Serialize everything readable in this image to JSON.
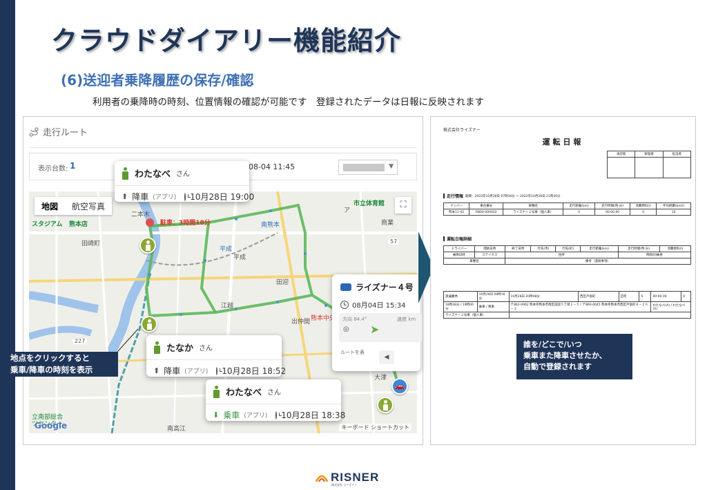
{
  "slide": {
    "title": "クラウドダイアリー機能紹介",
    "subtitle": "(6)送迎者乗降履歴の保存/確認",
    "description": "利用者の乗降時の時刻、位置情報の確認が可能です　登録されたデータは日報に反映されます"
  },
  "app": {
    "route_header": "走行ルート",
    "count_label": "表示台数:",
    "count_value": "1",
    "date_value": "2-08-04 11:45",
    "map_type": {
      "map": "地図",
      "satellite": "航空写真"
    },
    "fullscreen": "⛶",
    "google": "Google",
    "footer": "キーボード ショートカット",
    "labels": {
      "stadium": "スタジアム",
      "store": "熊本店",
      "tazaki": "田崎町",
      "takahira": "二本木",
      "jinnai": "南熊本",
      "hirasei": "平成",
      "hirasei2": "平成",
      "ezu": "江越",
      "izumi": "出仲間",
      "kumamoto_south": "熊本中央",
      "tamagawa": "田迎",
      "parking": "駐車：3時間18分",
      "city_hall": "市立体育館",
      "okusaku": "南熊本",
      "shoko": "商業",
      "ozu": "大津",
      "center": "立南部総合\nツセンター",
      "oe": "南高江",
      "ra": "ア",
      "s227": "227",
      "s57": "57"
    },
    "popups": [
      {
        "name": "わたなべ",
        "honorific": "さん",
        "action": "降車",
        "source": "(アプリ)",
        "time": "10月28日 19:00"
      },
      {
        "name": "たなか",
        "honorific": "さん",
        "action": "降車",
        "source": "(アプリ)",
        "time": "10月28日 18:52"
      },
      {
        "name": "わたなべ",
        "honorific": "さん",
        "action": "乗車",
        "source": "(アプリ)",
        "time": "10月28日 18:38"
      }
    ],
    "vehicle": {
      "name": "ライズナー４号",
      "time": "08月04日 15:34",
      "direction_label": "方向 84.4°",
      "speed_label": "速度 km",
      "route_label": "ルートを表",
      "prev": "◀"
    },
    "callout": "地点をクリックすると\n乗車/降車の時刻を表示"
  },
  "report": {
    "company": "株式会社ライズナー",
    "title": "運転日報",
    "approval": [
      "承認者",
      "管理者",
      "担当者"
    ],
    "travel_title": "走行情報",
    "travel_period": "期間：2022年10月28日 07時36分 ～ 2022年10月28日 21時36分",
    "travel_headers": [
      "ナンバー",
      "車台番号",
      "車種名",
      "走行距離(km)",
      "走行時間(時:分)",
      "消費燃料(l)",
      "平均燃費(km/l)"
    ],
    "travel_row": [
      "熊本11-02",
      "RB00-000002",
      "ライズナー２号車（個人車）",
      "0",
      "00:00.00",
      "0",
      "10"
    ],
    "detail_title": "運転日報詳細",
    "detail_headers1": [
      "ドライバー",
      "開始日時",
      "終了日時",
      "行先(市)",
      "行先(町)",
      "走行距離(km)",
      "走行時間(時:分)",
      "消費燃料(l)"
    ],
    "detail_headers2": [
      "乗降日時",
      "ステイタス",
      "住所",
      "時間/同乗者"
    ],
    "detail_headers3": [
      "車種名",
      "備考（連絡事項）"
    ],
    "record_rows": [
      [
        "渡邊慶秀",
        "10月28日 08時16分",
        "10月28日 20時48分",
        "西区戸坂町",
        "自宅",
        "0",
        "00:00.00",
        "0"
      ],
      [
        "18時38分 / 19時00分",
        "乗車 / 降車",
        "〒862-0962 熊本県熊本市南区田迎５丁目１－５ / 〒860-0045 熊本県熊本市西区戸坂町８－２６－１",
        "わたなべ(A) / わたなべ(A)"
      ],
      [
        "ライズナー２号車（個人車）",
        "",
        "",
        ""
      ]
    ],
    "callout": "誰を/どこで/いつ\n乗車また降車させたか、\n自動で登録されます"
  },
  "brand": {
    "logo": "RISNER",
    "sub": "株式会社 ライズナー"
  },
  "colors": {
    "navy": "#1f3558",
    "accent_blue": "#3d6fb3",
    "route_green": "#5cb85c",
    "pin_green": "#8aa832"
  }
}
